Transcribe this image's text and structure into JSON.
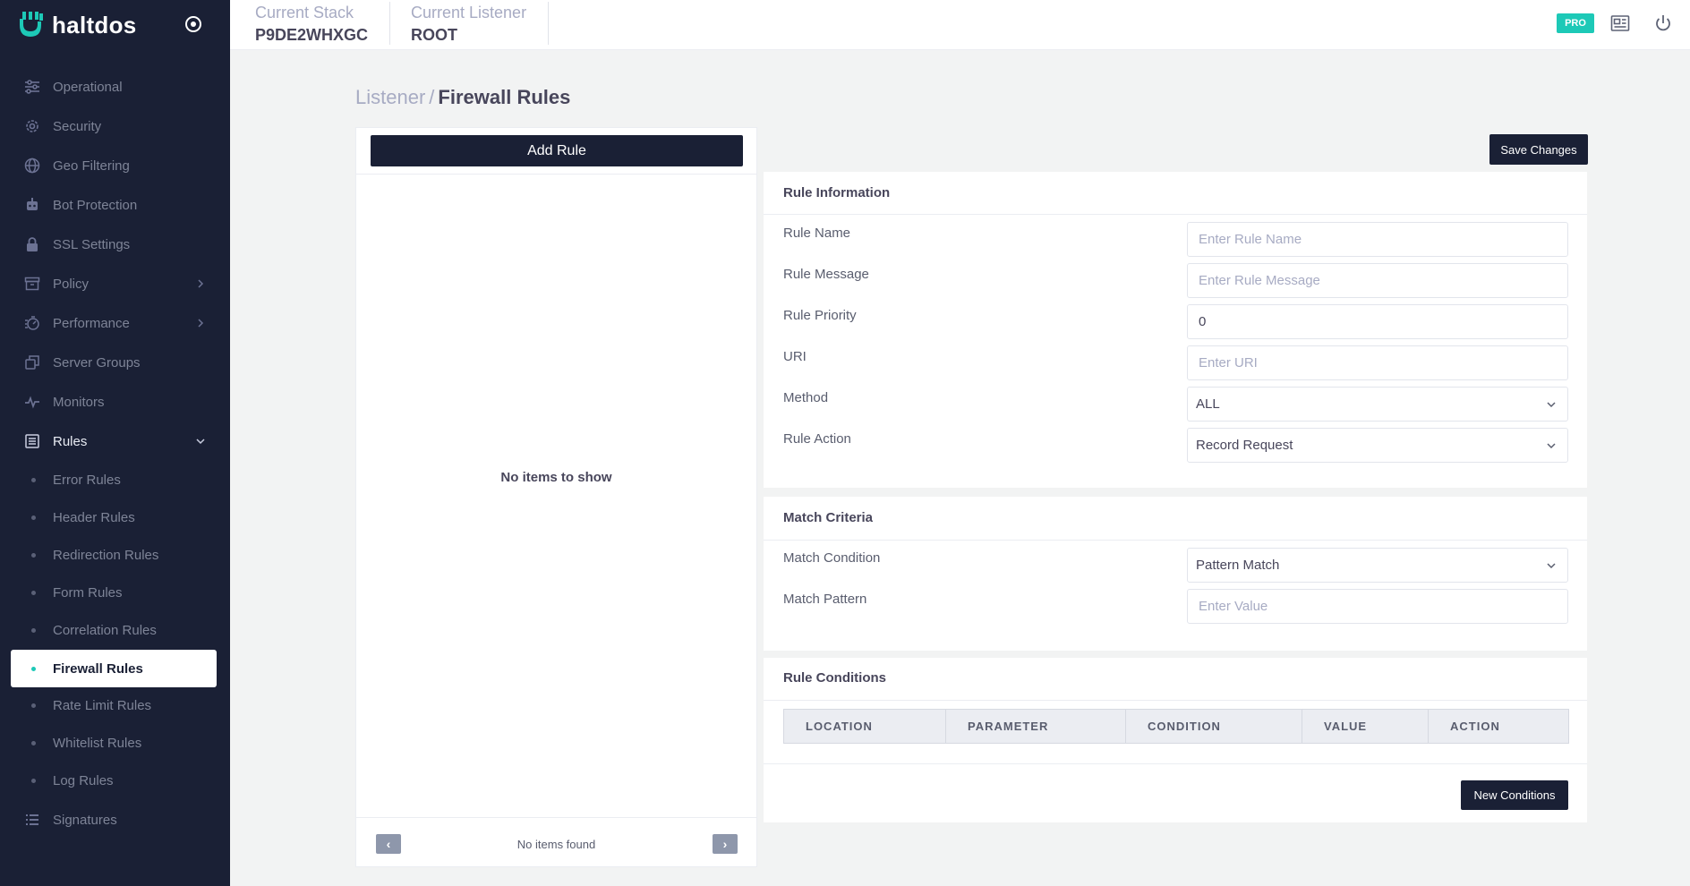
{
  "brand": {
    "name": "haltdos"
  },
  "header": {
    "stack_label": "Current Stack",
    "stack_value": "P9DE2WHXGC",
    "listener_label": "Current Listener",
    "listener_value": "ROOT",
    "badge": "PRO"
  },
  "sidebar": {
    "items": [
      {
        "label": "Operational",
        "icon": "sliders-icon"
      },
      {
        "label": "Security",
        "icon": "gear-icon"
      },
      {
        "label": "Geo Filtering",
        "icon": "globe-icon"
      },
      {
        "label": "Bot Protection",
        "icon": "bot-icon"
      },
      {
        "label": "SSL Settings",
        "icon": "lock-icon"
      },
      {
        "label": "Policy",
        "icon": "archive-icon"
      },
      {
        "label": "Performance",
        "icon": "speed-icon"
      },
      {
        "label": "Server Groups",
        "icon": "servers-icon"
      },
      {
        "label": "Monitors",
        "icon": "pulse-icon"
      },
      {
        "label": "Rules",
        "icon": "list-icon"
      },
      {
        "label": "Signatures",
        "icon": "bullet-list-icon"
      }
    ],
    "rules_sub": [
      {
        "label": "Error Rules"
      },
      {
        "label": "Header Rules"
      },
      {
        "label": "Redirection Rules"
      },
      {
        "label": "Form Rules"
      },
      {
        "label": "Correlation Rules"
      },
      {
        "label": "Firewall Rules"
      },
      {
        "label": "Rate Limit Rules"
      },
      {
        "label": "Whitelist Rules"
      },
      {
        "label": "Log Rules"
      }
    ]
  },
  "breadcrumb": {
    "parent": "Listener",
    "separator": "/",
    "current": "Firewall Rules"
  },
  "list_panel": {
    "add_label": "Add Rule",
    "empty_text": "No items to show",
    "footer_text": "No items found",
    "prev": "‹",
    "next": "›"
  },
  "save_label": "Save Changes",
  "rule_info": {
    "title": "Rule Information",
    "rule_name_label": "Rule Name",
    "rule_name_placeholder": "Enter Rule Name",
    "rule_message_label": "Rule Message",
    "rule_message_placeholder": "Enter Rule Message",
    "rule_priority_label": "Rule Priority",
    "rule_priority_value": "0",
    "uri_label": "URI",
    "uri_placeholder": "Enter URI",
    "method_label": "Method",
    "method_value": "ALL",
    "action_label": "Rule Action",
    "action_value": "Record Request"
  },
  "match": {
    "title": "Match Criteria",
    "condition_label": "Match Condition",
    "condition_value": "Pattern Match",
    "pattern_label": "Match Pattern",
    "pattern_placeholder": "Enter Value"
  },
  "conditions": {
    "title": "Rule Conditions",
    "columns": [
      "LOCATION",
      "PARAMETER",
      "CONDITION",
      "VALUE",
      "ACTION"
    ],
    "new_label": "New Conditions"
  },
  "colors": {
    "sidebar": "#1a2035",
    "accent": "#1dc9b7",
    "button": "#1a2035"
  }
}
